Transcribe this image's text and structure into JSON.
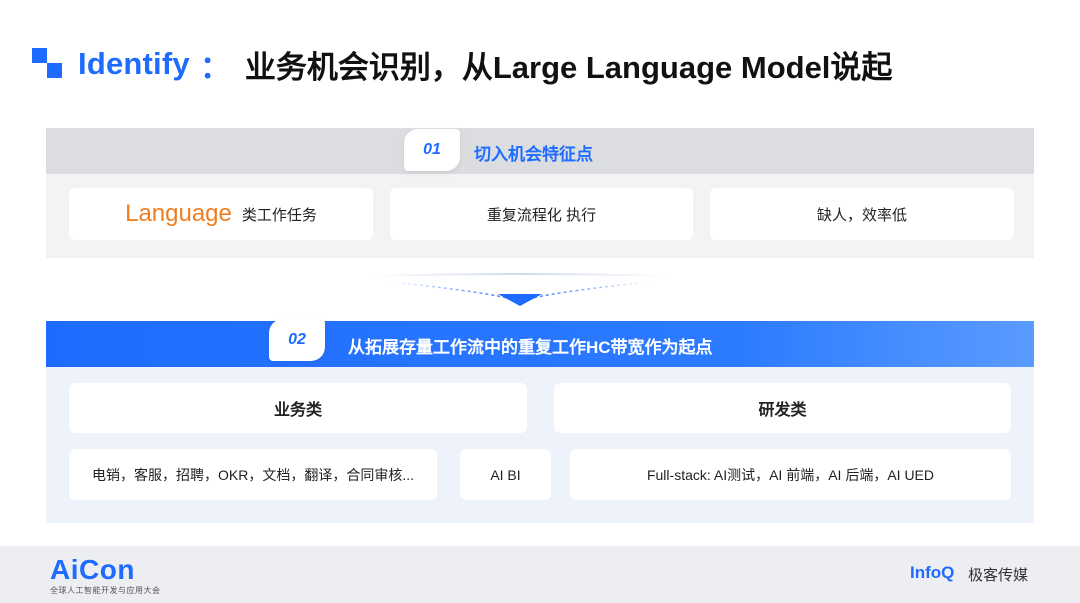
{
  "title": {
    "english": "Identify",
    "colon": "：",
    "chinese": "业务机会识别，从Large Language Model说起"
  },
  "section1": {
    "badge": "01",
    "title": "切入机会特征点",
    "cards": [
      {
        "highlight": "Language",
        "text": "类工作任务"
      },
      {
        "text": "重复流程化 执行"
      },
      {
        "text": "缺人，效率低"
      }
    ]
  },
  "section2": {
    "badge": "02",
    "title": "从拓展存量工作流中的重复工作HC带宽作为起点",
    "headers": [
      "业务类",
      "研发类"
    ],
    "items": [
      "电销，客服，招聘，OKR，文档，翻译，合同审核...",
      "AI BI",
      "Full-stack: AI测试，AI 前端，AI 后端，AI UED"
    ]
  },
  "footer": {
    "brand": "AiCon",
    "brand_sub": "全球人工智能开发与应用大会",
    "partner": "InfoQ",
    "partner_cn": "极客传媒"
  },
  "colors": {
    "accent": "#1f6bff",
    "orange": "#ef7e22"
  }
}
